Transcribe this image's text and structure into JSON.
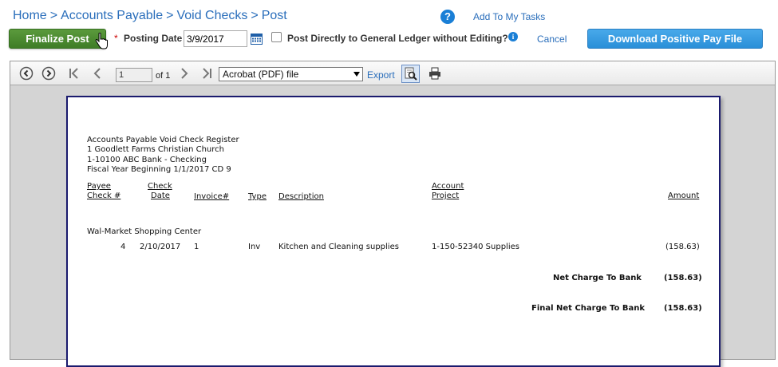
{
  "breadcrumb": {
    "home": "Home",
    "sep": ">",
    "accounts_payable": "Accounts Payable",
    "void_checks": "Void Checks",
    "post": "Post"
  },
  "header": {
    "help_glyph": "?",
    "add_to_tasks": "Add To My Tasks"
  },
  "actions": {
    "finalize_label": "Finalize Post",
    "required_star": "*",
    "posting_date_label": "Posting Date",
    "posting_date_value": "3/9/2017",
    "post_gl_label": "Post Directly to General Ledger without Editing?",
    "post_gl_checked": false,
    "info_glyph": "i",
    "cancel_label": "Cancel",
    "download_label": "Download Positive Pay File"
  },
  "viewer": {
    "page_value": "1",
    "page_of": "of 1",
    "format_selected": "Acrobat (PDF) file",
    "export_label": "Export"
  },
  "report": {
    "title_lines": [
      "Accounts Payable Void Check Register",
      "1 Goodlett Farms Christian Church",
      "1-10100 ABC Bank - Checking",
      "Fiscal Year Beginning 1/1/2017 CD 9"
    ],
    "headers": {
      "payee": "Payee",
      "check_no": "Check #",
      "check": "Check",
      "date": "Date",
      "invoice": "Invoice#",
      "type": "Type",
      "description": "Description",
      "account": "Account",
      "project": "Project",
      "amount": "Amount"
    },
    "payee_name": "Wal-Market Shopping Center",
    "row": {
      "check_no": "4",
      "date": "2/10/2017",
      "invoice": "1",
      "type": "Inv",
      "description": "Kitchen and Cleaning supplies",
      "account": "1-150-52340 Supplies",
      "amount": "(158.63)"
    },
    "net_charge_label": "Net Charge To Bank",
    "net_charge_value": "(158.63)",
    "final_charge_label": "Final Net Charge To Bank",
    "final_charge_value": "(158.63)"
  },
  "colors": {
    "link": "#2a6ebb",
    "finalize_bg": "#4a8a30",
    "download_bg": "#3a9be0"
  }
}
